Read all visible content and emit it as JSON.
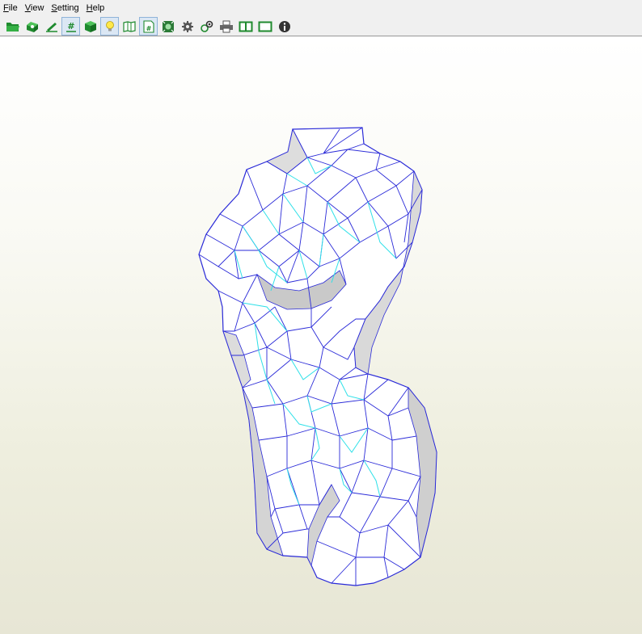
{
  "menubar": {
    "items": [
      {
        "label": "File",
        "mnemonic": "F",
        "rest": "ile"
      },
      {
        "label": "View",
        "mnemonic": "V",
        "rest": "iew"
      },
      {
        "label": "Setting",
        "mnemonic": "S",
        "rest": "etting"
      },
      {
        "label": "Help",
        "mnemonic": "H",
        "rest": "elp"
      }
    ]
  },
  "toolbar": {
    "buttons": [
      {
        "icon": "open-folder-icon",
        "pressed": false
      },
      {
        "icon": "unfold-icon",
        "pressed": false
      },
      {
        "icon": "edit-pen-icon",
        "pressed": false
      },
      {
        "icon": "show-numbers-icon",
        "label": "#",
        "pressed": true
      },
      {
        "icon": "3d-box-icon",
        "pressed": false
      },
      {
        "icon": "light-bulb-icon",
        "pressed": true
      },
      {
        "icon": "show-flaps-icon",
        "pressed": false
      },
      {
        "icon": "edge-id-icon",
        "label": "#",
        "pressed": true
      },
      {
        "icon": "fit-view-icon",
        "pressed": false
      },
      {
        "icon": "settings-gear-icon",
        "pressed": false
      },
      {
        "icon": "view-options-icon",
        "pressed": false
      },
      {
        "icon": "print-icon",
        "pressed": false
      },
      {
        "icon": "split-view-icon",
        "pressed": false
      },
      {
        "icon": "single-view-icon",
        "pressed": false
      },
      {
        "icon": "info-icon",
        "pressed": false
      }
    ]
  },
  "colors": {
    "mesh_edges": "#2a2ad8",
    "fold_lines": "#2ee0e8",
    "face_fill": "#ffffff",
    "face_shade": "#d6d6d6",
    "toolbar_icon_green": "#1f8a2e"
  }
}
